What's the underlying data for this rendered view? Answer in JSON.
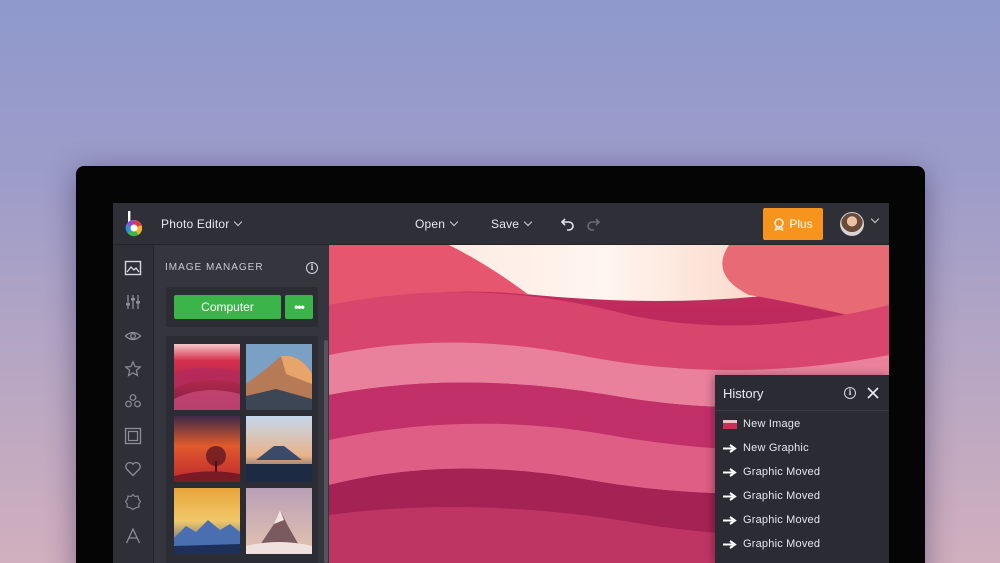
{
  "topbar": {
    "app_menu": "Photo Editor",
    "open_label": "Open",
    "save_label": "Save",
    "plus_label": "Plus"
  },
  "image_manager": {
    "title": "IMAGE MANAGER",
    "computer_label": "Computer",
    "more_label": "•••",
    "info_glyph": "i",
    "thumbnails": [
      "red-canyon",
      "half-dome",
      "sunset-tree",
      "mount-fuji",
      "mountain-range",
      "matterhorn"
    ]
  },
  "history": {
    "title": "History",
    "info_glyph": "i",
    "items": [
      {
        "label": "New Image",
        "icon": "image-thumb-icon"
      },
      {
        "label": "New Graphic",
        "icon": "arrow-right-icon"
      },
      {
        "label": "Graphic Moved",
        "icon": "arrow-right-icon"
      },
      {
        "label": "Graphic Moved",
        "icon": "arrow-right-icon"
      },
      {
        "label": "Graphic Moved",
        "icon": "arrow-right-icon"
      },
      {
        "label": "Graphic Moved",
        "icon": "arrow-right-icon"
      }
    ]
  },
  "sidebar_icons": [
    "image-icon",
    "sliders-icon",
    "eye-icon",
    "star-icon",
    "effects-icon",
    "frame-icon",
    "heart-icon",
    "badge-icon",
    "text-icon"
  ],
  "colors": {
    "accent_green": "#3bb54a",
    "plus_orange": "#f7941d",
    "app_bg": "#2a2a33"
  }
}
